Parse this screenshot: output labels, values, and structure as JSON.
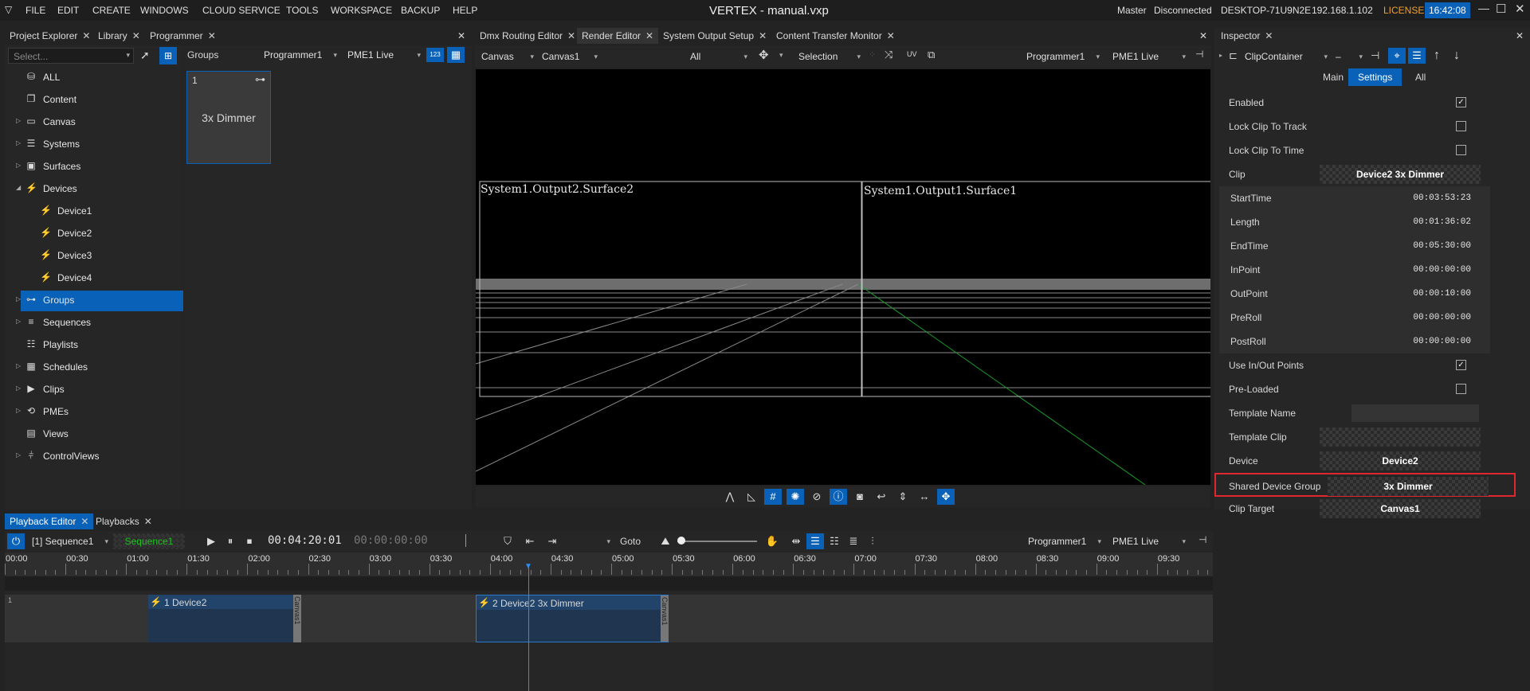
{
  "app": {
    "title": "VERTEX - manual.vxp",
    "logo": "vertex-logo-icon"
  },
  "menu": [
    "FILE",
    "EDIT",
    "CREATE",
    "WINDOWS",
    "CLOUD SERVICE",
    "TOOLS",
    "WORKSPACE",
    "BACKUP",
    "HELP"
  ],
  "status": {
    "role": "Master",
    "connection": "Disconnected",
    "host": "DESKTOP-71U9N2E",
    "ip": "192.168.1.102",
    "license": "LICENSE",
    "time": "16:42:08"
  },
  "left_tabs": [
    "Project Explorer",
    "Library",
    "Programmer"
  ],
  "explorer": {
    "select_placeholder": "Select...",
    "items": [
      {
        "label": "ALL",
        "icon": "database-icon",
        "arrow": ""
      },
      {
        "label": "Content",
        "icon": "content-icon",
        "arrow": ""
      },
      {
        "label": "Canvas",
        "icon": "canvas-icon",
        "arrow": "▷"
      },
      {
        "label": "Systems",
        "icon": "systems-icon",
        "arrow": "▷"
      },
      {
        "label": "Surfaces",
        "icon": "surfaces-icon",
        "arrow": "▷"
      },
      {
        "label": "Devices",
        "icon": "devices-icon",
        "arrow": "◢"
      },
      {
        "label": "Device1",
        "icon": "device-icon",
        "arrow": ""
      },
      {
        "label": "Device2",
        "icon": "device-icon",
        "arrow": ""
      },
      {
        "label": "Device3",
        "icon": "device-icon",
        "arrow": ""
      },
      {
        "label": "Device4",
        "icon": "device-icon",
        "arrow": ""
      },
      {
        "label": "Groups",
        "icon": "groups-icon",
        "arrow": "▷"
      },
      {
        "label": "Sequences",
        "icon": "sequences-icon",
        "arrow": "▷"
      },
      {
        "label": "Playlists",
        "icon": "playlists-icon",
        "arrow": ""
      },
      {
        "label": "Schedules",
        "icon": "schedules-icon",
        "arrow": "▷"
      },
      {
        "label": "Clips",
        "icon": "clips-icon",
        "arrow": "▷"
      },
      {
        "label": "PMEs",
        "icon": "pmes-icon",
        "arrow": "▷"
      },
      {
        "label": "Views",
        "icon": "views-icon",
        "arrow": ""
      },
      {
        "label": "ControlViews",
        "icon": "controlviews-icon",
        "arrow": "▷"
      }
    ]
  },
  "groups": {
    "label": "Groups",
    "programmer": "Programmer1",
    "pme": "PME1 Live",
    "num_btn": "123",
    "card": {
      "index": "1",
      "name": "3x Dimmer"
    }
  },
  "center_tabs": [
    "Dmx Routing Editor",
    "Render Editor",
    "System Output Setup",
    "Content Transfer Monitor"
  ],
  "render": {
    "canvas_dd": "Canvas",
    "canvas1_dd": "Canvas1",
    "filter": "All",
    "mode": "Selection",
    "uv": "UV",
    "programmer": "Programmer1",
    "pme": "PME1 Live",
    "surface_left": "System1.Output2.Surface2",
    "surface_right": "System1.Output1.Surface1"
  },
  "inspector": {
    "tab": "Inspector",
    "object": "ClipContainer",
    "dash": "–",
    "subtabs": [
      "Main",
      "Settings",
      "All"
    ],
    "active_subtab": "Settings",
    "props": [
      {
        "k": "Enabled",
        "type": "check",
        "v": true
      },
      {
        "k": "Lock Clip To Track",
        "type": "check",
        "v": false
      },
      {
        "k": "Lock Clip To Time",
        "type": "check",
        "v": false
      },
      {
        "k": "Clip",
        "type": "ref",
        "v": "Device2 3x Dimmer"
      },
      {
        "k": "StartTime",
        "type": "time",
        "v": "00:03:53:23"
      },
      {
        "k": "Length",
        "type": "time",
        "v": "00:01:36:02"
      },
      {
        "k": "EndTime",
        "type": "time",
        "v": "00:05:30:00"
      },
      {
        "k": "InPoint",
        "type": "time",
        "v": "00:00:00:00"
      },
      {
        "k": "OutPoint",
        "type": "time",
        "v": "00:00:10:00"
      },
      {
        "k": "PreRoll",
        "type": "time",
        "v": "00:00:00:00"
      },
      {
        "k": "PostRoll",
        "type": "time",
        "v": "00:00:00:00"
      },
      {
        "k": "Use In/Out Points",
        "type": "check",
        "v": true
      },
      {
        "k": "Pre-Loaded",
        "type": "check",
        "v": false
      },
      {
        "k": "Template Name",
        "type": "text",
        "v": ""
      },
      {
        "k": "Template Clip",
        "type": "ref",
        "v": ""
      },
      {
        "k": "Device",
        "type": "ref",
        "v": "Device2"
      },
      {
        "k": "Shared Device Group",
        "type": "ref",
        "v": "3x Dimmer"
      },
      {
        "k": "Clip Target",
        "type": "ref",
        "v": "Canvas1"
      }
    ]
  },
  "playback": {
    "tabs": [
      "Playback Editor",
      "Playbacks"
    ],
    "sequence": "[1] Sequence1",
    "seq_name": "Sequence1",
    "timecode": "00:04:20:01",
    "timecode2": "00:00:00:00",
    "goto": "Goto",
    "programmer": "Programmer1",
    "pme": "PME1 Live",
    "ruler": [
      "00:00",
      "00:30",
      "01:00",
      "01:30",
      "02:00",
      "02:30",
      "03:00",
      "03:30",
      "04:00",
      "04:30",
      "05:00",
      "05:30",
      "06:00",
      "06:30",
      "07:00",
      "07:30",
      "08:00",
      "08:30",
      "09:00",
      "09:30"
    ],
    "track_index": "1",
    "clips": [
      {
        "label": "1 Device2",
        "target": "Canvas1"
      },
      {
        "label": "2 Device2 3x Dimmer",
        "target": "Canvas1"
      }
    ]
  },
  "colors": {
    "accent": "#0a62b8",
    "highlight_border": "#e0262e",
    "canvas_bg": "#000000"
  }
}
